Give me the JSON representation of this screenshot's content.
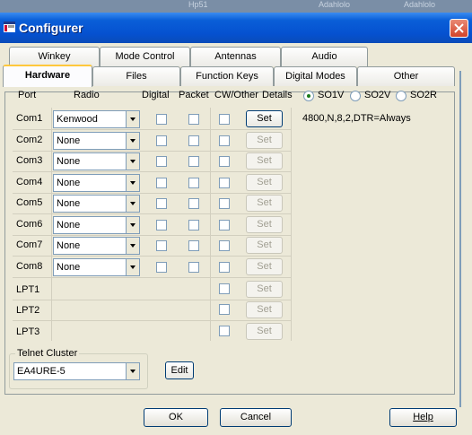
{
  "background_strip": [
    "Hp51",
    "Adahlolo",
    "Adahlolo"
  ],
  "window": {
    "title": "Configurer",
    "icon": "window-app-icon"
  },
  "tabs_row1": [
    {
      "label": "Winkey"
    },
    {
      "label": "Mode Control"
    },
    {
      "label": "Antennas"
    },
    {
      "label": "Audio"
    }
  ],
  "tabs_row2": [
    {
      "label": "Hardware",
      "active": true
    },
    {
      "label": "Files"
    },
    {
      "label": "Function Keys"
    },
    {
      "label": "Digital Modes"
    },
    {
      "label": "Other"
    }
  ],
  "columns": {
    "port": "Port",
    "radio": "Radio",
    "digital": "Digital",
    "packet": "Packet",
    "cw_other": "CW/Other",
    "details": "Details"
  },
  "so_radios": [
    {
      "label": "SO1V",
      "selected": true
    },
    {
      "label": "SO2V",
      "selected": false
    },
    {
      "label": "SO2R",
      "selected": false
    }
  ],
  "com_settings": "4800,N,8,2,DTR=Always",
  "rows": [
    {
      "port": "Com1",
      "radio": "Kenwood",
      "details": "Set",
      "enabled": true
    },
    {
      "port": "Com2",
      "radio": "None",
      "details": "Set",
      "enabled": false
    },
    {
      "port": "Com3",
      "radio": "None",
      "details": "Set",
      "enabled": false
    },
    {
      "port": "Com4",
      "radio": "None",
      "details": "Set",
      "enabled": false
    },
    {
      "port": "Com5",
      "radio": "None",
      "details": "Set",
      "enabled": false
    },
    {
      "port": "Com6",
      "radio": "None",
      "details": "Set",
      "enabled": false
    },
    {
      "port": "Com7",
      "radio": "None",
      "details": "Set",
      "enabled": false
    },
    {
      "port": "Com8",
      "radio": "None",
      "details": "Set",
      "enabled": false
    }
  ],
  "lpt_rows": [
    {
      "port": "LPT1",
      "details": "Set"
    },
    {
      "port": "LPT2",
      "details": "Set"
    },
    {
      "port": "LPT3",
      "details": "Set"
    }
  ],
  "telnet": {
    "label": "Telnet Cluster",
    "value": "EA4URE-5",
    "edit_label": "Edit"
  },
  "buttons": {
    "ok": "OK",
    "cancel": "Cancel",
    "help": "Help"
  },
  "colors": {
    "titlebar": "#0551d0",
    "tab_highlight": "#ffc83c",
    "radio_dot": "#1a7a1a"
  }
}
